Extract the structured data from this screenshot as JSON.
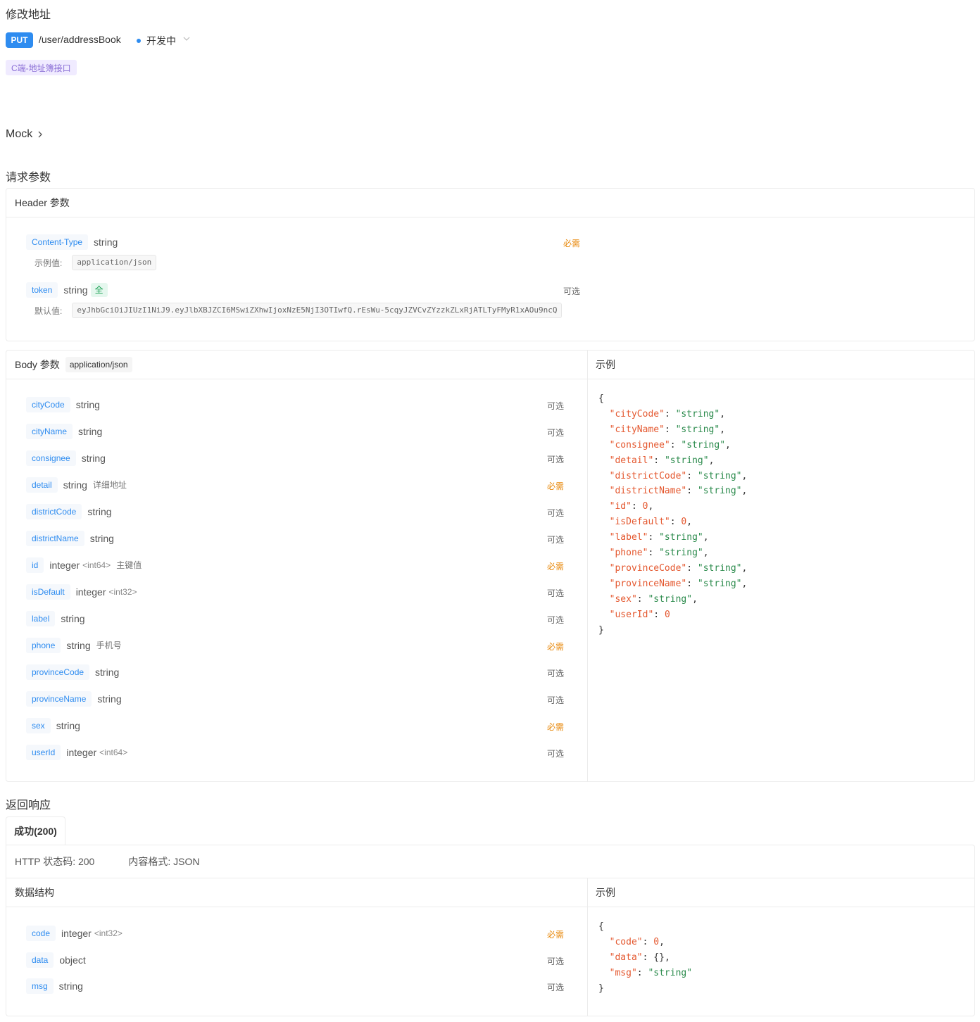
{
  "page_title": "修改地址",
  "method": "PUT",
  "path": "/user/addressBook",
  "status": "开发中",
  "tag": "C端-地址簿接口",
  "mock_label": "Mock",
  "request_title": "请求参数",
  "header_section": {
    "title": "Header 参数",
    "params": [
      {
        "name": "Content-Type",
        "type": "string",
        "flag": "必需",
        "value_label": "示例值:",
        "value": "application/json"
      },
      {
        "name": "token",
        "type": "string",
        "badge": "全",
        "flag": "可选",
        "value_label": "默认值:",
        "value": "eyJhbGciOiJIUzI1NiJ9.eyJlbXBJZCI6MSwiZXhwIjoxNzE5NjI3OTIwfQ.rEsWu-5cqyJZVCvZYzzkZLxRjATLTyFMyR1xAOu9ncQ"
      }
    ]
  },
  "body_section": {
    "title": "Body 参数",
    "content_type": "application/json",
    "example_title": "示例",
    "params": [
      {
        "name": "cityCode",
        "type": "string",
        "fmt": "",
        "desc": "",
        "flag": "可选"
      },
      {
        "name": "cityName",
        "type": "string",
        "fmt": "",
        "desc": "",
        "flag": "可选"
      },
      {
        "name": "consignee",
        "type": "string",
        "fmt": "",
        "desc": "",
        "flag": "可选"
      },
      {
        "name": "detail",
        "type": "string",
        "fmt": "",
        "desc": "详细地址",
        "flag": "必需"
      },
      {
        "name": "districtCode",
        "type": "string",
        "fmt": "",
        "desc": "",
        "flag": "可选"
      },
      {
        "name": "districtName",
        "type": "string",
        "fmt": "",
        "desc": "",
        "flag": "可选"
      },
      {
        "name": "id",
        "type": "integer",
        "fmt": "<int64>",
        "desc": "主键值",
        "flag": "必需"
      },
      {
        "name": "isDefault",
        "type": "integer",
        "fmt": "<int32>",
        "desc": "",
        "flag": "可选"
      },
      {
        "name": "label",
        "type": "string",
        "fmt": "",
        "desc": "",
        "flag": "可选"
      },
      {
        "name": "phone",
        "type": "string",
        "fmt": "",
        "desc": "手机号",
        "flag": "必需"
      },
      {
        "name": "provinceCode",
        "type": "string",
        "fmt": "",
        "desc": "",
        "flag": "可选"
      },
      {
        "name": "provinceName",
        "type": "string",
        "fmt": "",
        "desc": "",
        "flag": "可选"
      },
      {
        "name": "sex",
        "type": "string",
        "fmt": "",
        "desc": "",
        "flag": "必需"
      },
      {
        "name": "userId",
        "type": "integer",
        "fmt": "<int64>",
        "desc": "",
        "flag": "可选"
      }
    ],
    "example_lines": [
      {
        "k": "cityCode",
        "v": "\"string\"",
        "t": "s"
      },
      {
        "k": "cityName",
        "v": "\"string\"",
        "t": "s"
      },
      {
        "k": "consignee",
        "v": "\"string\"",
        "t": "s"
      },
      {
        "k": "detail",
        "v": "\"string\"",
        "t": "s"
      },
      {
        "k": "districtCode",
        "v": "\"string\"",
        "t": "s"
      },
      {
        "k": "districtName",
        "v": "\"string\"",
        "t": "s"
      },
      {
        "k": "id",
        "v": "0",
        "t": "n"
      },
      {
        "k": "isDefault",
        "v": "0",
        "t": "n"
      },
      {
        "k": "label",
        "v": "\"string\"",
        "t": "s"
      },
      {
        "k": "phone",
        "v": "\"string\"",
        "t": "s"
      },
      {
        "k": "provinceCode",
        "v": "\"string\"",
        "t": "s"
      },
      {
        "k": "provinceName",
        "v": "\"string\"",
        "t": "s"
      },
      {
        "k": "sex",
        "v": "\"string\"",
        "t": "s"
      },
      {
        "k": "userId",
        "v": "0",
        "t": "n"
      }
    ]
  },
  "response_title": "返回响应",
  "response_tab": "成功(200)",
  "http_status": "HTTP 状态码: 200",
  "content_format": "内容格式: JSON",
  "response_section": {
    "title": "数据结构",
    "example_title": "示例",
    "params": [
      {
        "name": "code",
        "type": "integer",
        "fmt": "<int32>",
        "desc": "",
        "flag": "必需"
      },
      {
        "name": "data",
        "type": "object",
        "fmt": "",
        "desc": "",
        "flag": "可选"
      },
      {
        "name": "msg",
        "type": "string",
        "fmt": "",
        "desc": "",
        "flag": "可选"
      }
    ],
    "example_lines": [
      {
        "k": "code",
        "v": "0",
        "t": "n"
      },
      {
        "k": "data",
        "v": "{}",
        "t": "p"
      },
      {
        "k": "msg",
        "v": "\"string\"",
        "t": "s"
      }
    ]
  },
  "colors": {
    "accent": "#2e8cf0",
    "required": "#e8890c",
    "tag_bg": "#f0ebff",
    "json_key": "#e4572e",
    "json_string": "#2a8a4b"
  },
  "icons": {
    "status": "status-dot-icon",
    "dropdown": "chevron-down-icon",
    "mock": "chevron-right-icon"
  }
}
